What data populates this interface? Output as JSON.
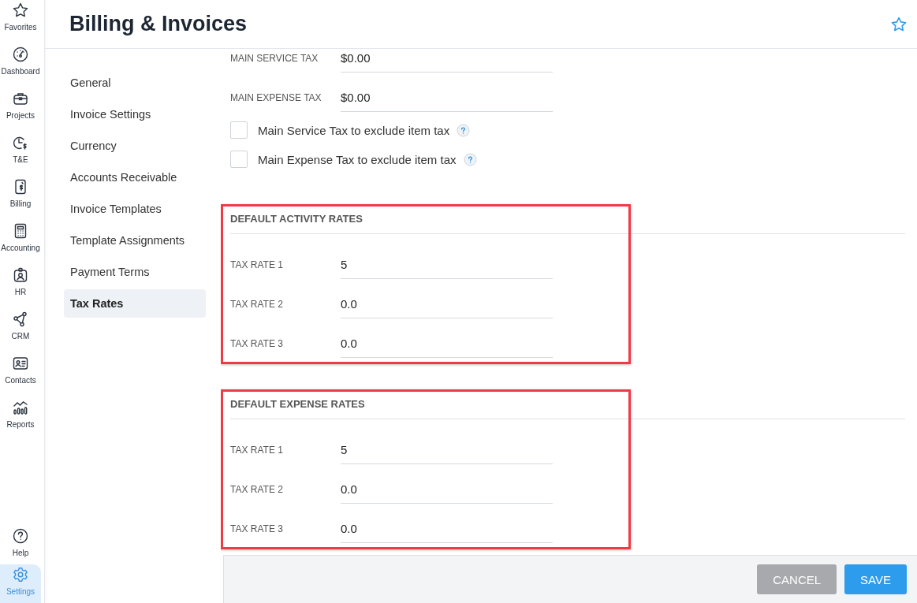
{
  "sidebar": {
    "items": [
      {
        "label": "Favorites",
        "selected": false
      },
      {
        "label": "Dashboard",
        "selected": false
      },
      {
        "label": "Projects",
        "selected": false
      },
      {
        "label": "T&E",
        "selected": false
      },
      {
        "label": "Billing",
        "selected": false
      },
      {
        "label": "Accounting",
        "selected": false
      },
      {
        "label": "HR",
        "selected": false
      },
      {
        "label": "CRM",
        "selected": false
      },
      {
        "label": "Contacts",
        "selected": false
      },
      {
        "label": "Reports",
        "selected": false
      }
    ],
    "bottom_items": [
      {
        "label": "Help",
        "selected": false
      },
      {
        "label": "Settings",
        "selected": true
      }
    ]
  },
  "header": {
    "title": "Billing & Invoices"
  },
  "nav": {
    "items": [
      {
        "label": "General",
        "selected": false
      },
      {
        "label": "Invoice Settings",
        "selected": false
      },
      {
        "label": "Currency",
        "selected": false
      },
      {
        "label": "Accounts Receivable",
        "selected": false
      },
      {
        "label": "Invoice Templates",
        "selected": false
      },
      {
        "label": "Template Assignments",
        "selected": false
      },
      {
        "label": "Payment Terms",
        "selected": false
      },
      {
        "label": "Tax Rates",
        "selected": true
      }
    ]
  },
  "fields": [
    {
      "label": "MAIN SERVICE TAX",
      "value": "$0.00"
    },
    {
      "label": "MAIN EXPENSE TAX",
      "value": "$0.00"
    }
  ],
  "checkboxes": [
    {
      "label": "Main Service Tax to exclude item tax",
      "checked": false
    },
    {
      "label": "Main Expense Tax to exclude item tax",
      "checked": false
    }
  ],
  "sections": [
    {
      "title": "DEFAULT ACTIVITY RATES",
      "highlighted": true,
      "rows": [
        {
          "label": "TAX RATE 1",
          "value": "5"
        },
        {
          "label": "TAX RATE 2",
          "value": "0.0"
        },
        {
          "label": "TAX RATE 3",
          "value": "0.0"
        }
      ]
    },
    {
      "title": "DEFAULT EXPENSE RATES",
      "highlighted": true,
      "rows": [
        {
          "label": "TAX RATE 1",
          "value": "5"
        },
        {
          "label": "TAX RATE 2",
          "value": "0.0"
        },
        {
          "label": "TAX RATE 3",
          "value": "0.0"
        }
      ]
    }
  ],
  "buttons": [
    {
      "label": "CANCEL",
      "kind": "secondary"
    },
    {
      "label": "SAVE",
      "kind": "primary"
    }
  ]
}
